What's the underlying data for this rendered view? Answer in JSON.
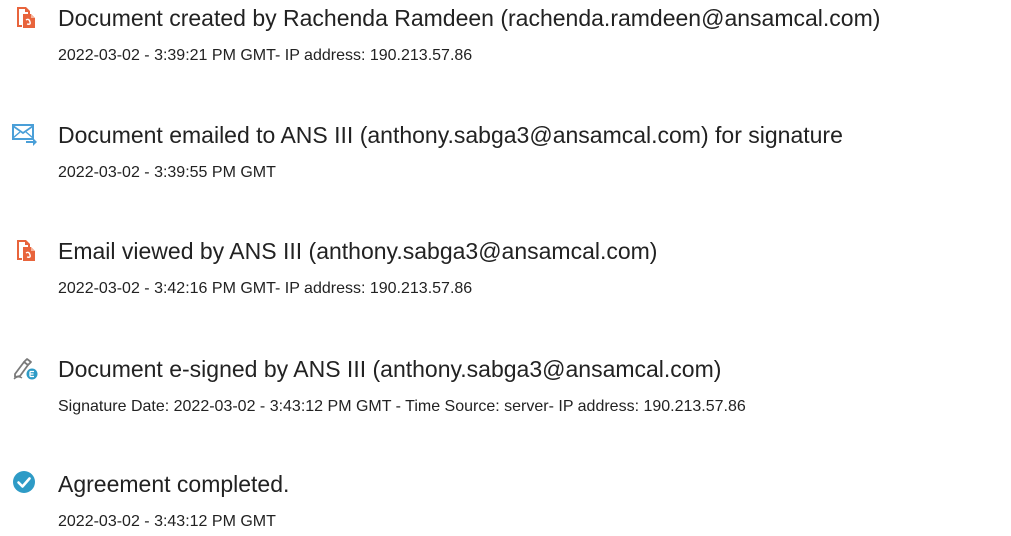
{
  "colors": {
    "pdf_icon": "#E8643C",
    "email_icon": "#4A9FD8",
    "sign_icon": "#7A7A7A",
    "sign_badge": "#2E9BC6",
    "complete_icon": "#2E9BC6",
    "text": "#222222"
  },
  "events": [
    {
      "icon": "document-icon",
      "title": "Document created by Rachenda Ramdeen (rachenda.ramdeen@ansamcal.com)",
      "detail": "2022-03-02 - 3:39:21 PM GMT- IP address: 190.213.57.86"
    },
    {
      "icon": "email-send-icon",
      "title": "Document emailed to ANS III (anthony.sabga3@ansamcal.com) for signature",
      "detail": "2022-03-02 - 3:39:55 PM GMT"
    },
    {
      "icon": "document-icon",
      "title": "Email viewed by ANS III (anthony.sabga3@ansamcal.com)",
      "detail": "2022-03-02 - 3:42:16 PM GMT- IP address: 190.213.57.86"
    },
    {
      "icon": "pen-sign-icon",
      "title": "Document e-signed by ANS III (anthony.sabga3@ansamcal.com)",
      "detail": "Signature Date: 2022-03-02 - 3:43:12 PM GMT - Time Source: server- IP address: 190.213.57.86"
    },
    {
      "icon": "checkmark-circle-icon",
      "title": "Agreement completed.",
      "detail": "2022-03-02 - 3:43:12 PM GMT"
    }
  ]
}
